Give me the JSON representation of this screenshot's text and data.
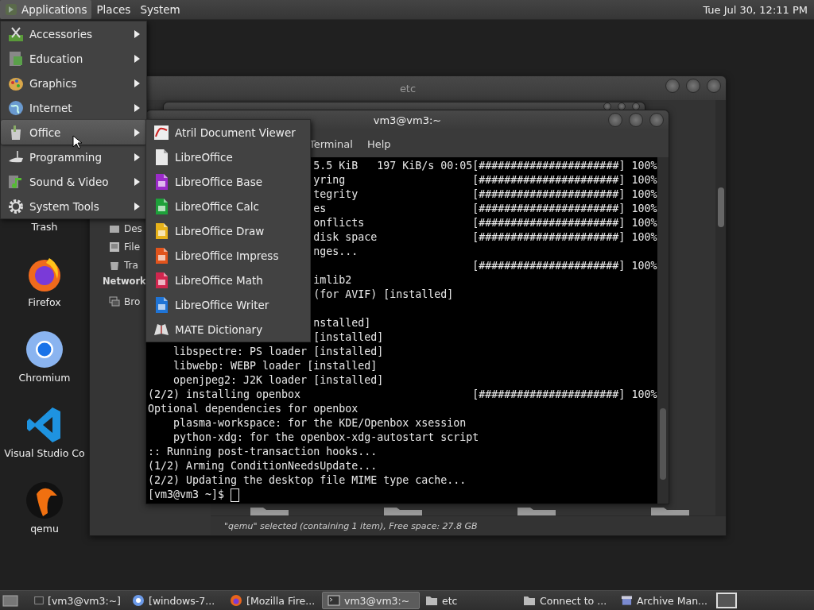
{
  "top_panel": {
    "menus": [
      {
        "label": "Applications",
        "selected": true
      },
      {
        "label": "Places",
        "selected": false
      },
      {
        "label": "System",
        "selected": false
      }
    ],
    "clock": "Tue Jul 30, 12:11 PM"
  },
  "applications_menu": {
    "items": [
      {
        "label": "Accessories",
        "selected": false
      },
      {
        "label": "Education",
        "selected": false
      },
      {
        "label": "Graphics",
        "selected": false
      },
      {
        "label": "Internet",
        "selected": false
      },
      {
        "label": "Office",
        "selected": true
      },
      {
        "label": "Programming",
        "selected": false
      },
      {
        "label": "Sound & Video",
        "selected": false
      },
      {
        "label": "System Tools",
        "selected": false
      }
    ]
  },
  "office_submenu": {
    "items": [
      {
        "label": "Atril Document Viewer"
      },
      {
        "label": "LibreOffice"
      },
      {
        "label": "LibreOffice Base"
      },
      {
        "label": "LibreOffice Calc"
      },
      {
        "label": "LibreOffice Draw"
      },
      {
        "label": "LibreOffice Impress"
      },
      {
        "label": "LibreOffice Math"
      },
      {
        "label": "LibreOffice Writer"
      },
      {
        "label": "MATE Dictionary"
      }
    ]
  },
  "desktop_icons": [
    {
      "label": "Trash"
    },
    {
      "label": "Firefox"
    },
    {
      "label": "Chromium"
    },
    {
      "label": "Visual Studio Co"
    },
    {
      "label": "qemu"
    }
  ],
  "file_manager": {
    "title": "etc",
    "places": [
      {
        "label": "Des"
      },
      {
        "label": "File"
      },
      {
        "label": "Tra"
      }
    ],
    "network_heading": "Network",
    "network": [
      {
        "label": "Bro"
      }
    ],
    "status": "\"qemu\" selected (containing 1 item), Free space: 27.8 GB"
  },
  "terminal": {
    "title": "vm3@vm3:~",
    "menus": [
      "Terminal",
      "Help"
    ],
    "lines": [
      {
        "kind": "covered",
        "text": "5.5 KiB   197 KiB/s 00:05",
        "progress": "[######################] 100%"
      },
      {
        "kind": "covered",
        "text": "yring",
        "progress": "[######################] 100%"
      },
      {
        "kind": "covered",
        "text": "tegrity",
        "progress": "[######################] 100%"
      },
      {
        "kind": "covered",
        "text": "es",
        "progress": "[######################] 100%"
      },
      {
        "kind": "covered",
        "text": "onflicts",
        "progress": "[######################] 100%"
      },
      {
        "kind": "covered",
        "text": "disk space",
        "progress": "[######################] 100%"
      },
      {
        "kind": "covered",
        "text": "nges..."
      },
      {
        "kind": "covered",
        "progress": "[######################] 100%"
      },
      {
        "kind": "covered",
        "text": "imlib2"
      },
      {
        "kind": "covered",
        "text": "(for AVIF) [installed]"
      },
      {
        "kind": "covered"
      },
      {
        "kind": "covered",
        "text": "nstalled]"
      },
      {
        "kind": "covered",
        "text": "[installed]"
      },
      {
        "kind": "indented",
        "text": "libspectre: PS loader [installed]"
      },
      {
        "kind": "indented",
        "text": "libwebp: WEBP loader [installed]"
      },
      {
        "kind": "indented",
        "text": "openjpeg2: J2K loader [installed]"
      },
      {
        "kind": "plain",
        "text": "(2/2) installing openbox",
        "progress": "[######################] 100%"
      },
      {
        "kind": "plain",
        "text": "Optional dependencies for openbox"
      },
      {
        "kind": "indented",
        "text": "plasma-workspace: for the KDE/Openbox xsession"
      },
      {
        "kind": "indented",
        "text": "python-xdg: for the openbox-xdg-autostart script"
      },
      {
        "kind": "plain",
        "text": ":: Running post-transaction hooks..."
      },
      {
        "kind": "plain",
        "text": "(1/2) Arming ConditionNeedsUpdate..."
      },
      {
        "kind": "plain",
        "text": "(2/2) Updating the desktop file MIME type cache..."
      },
      {
        "kind": "prompt",
        "text": "[vm3@vm3 ~]$"
      }
    ]
  },
  "taskbar": {
    "items": [
      {
        "label": "[vm3@vm3:~]",
        "selected": false
      },
      {
        "label": "[windows-7...",
        "selected": false
      },
      {
        "label": "[Mozilla Fire...",
        "selected": false
      },
      {
        "label": "vm3@vm3:~",
        "selected": true
      },
      {
        "label": "etc",
        "selected": false
      },
      {
        "label": "Connect to ...",
        "selected": false
      },
      {
        "label": "Archive Man...",
        "selected": false
      }
    ]
  }
}
